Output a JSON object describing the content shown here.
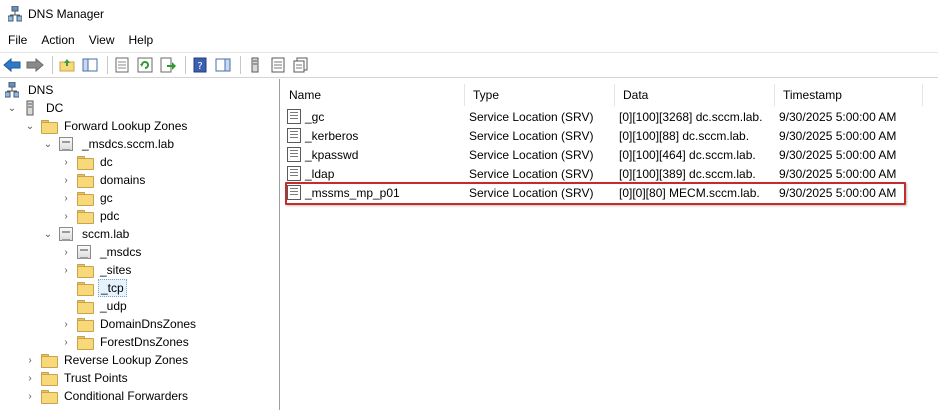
{
  "window": {
    "title": "DNS Manager",
    "icon": "dns-manager-icon"
  },
  "menu": [
    "File",
    "Action",
    "View",
    "Help"
  ],
  "toolbar": {
    "buttons": [
      "back-arrow-icon",
      "forward-arrow-icon",
      "up-folder-icon",
      "show-hide-tree-icon",
      "properties-icon",
      "refresh-icon",
      "export-list-icon",
      "help-icon",
      "action-pane-icon",
      "server-icon",
      "zone-icon",
      "records-icon"
    ]
  },
  "tree": {
    "root": "DNS",
    "server": "DC",
    "forward_zones": "Forward Lookup Zones",
    "msdcs_zone": "_msdcs.sccm.lab",
    "msdcs_children": [
      "dc",
      "domains",
      "gc",
      "pdc"
    ],
    "sccm_zone": "sccm.lab",
    "sccm_children": [
      "_msdcs",
      "_sites",
      "_tcp",
      "_udp",
      "DomainDnsZones",
      "ForestDnsZones"
    ],
    "reverse_zones": "Reverse Lookup Zones",
    "trust_points": "Trust Points",
    "conditional_forwarders": "Conditional Forwarders",
    "selected": "_tcp"
  },
  "list": {
    "columns": [
      "Name",
      "Type",
      "Data",
      "Timestamp"
    ],
    "rows": [
      {
        "name": "_gc",
        "type": "Service Location (SRV)",
        "data": "[0][100][3268] dc.sccm.lab.",
        "timestamp": "9/30/2025 5:00:00 AM"
      },
      {
        "name": "_kerberos",
        "type": "Service Location (SRV)",
        "data": "[0][100][88] dc.sccm.lab.",
        "timestamp": "9/30/2025 5:00:00 AM"
      },
      {
        "name": "_kpasswd",
        "type": "Service Location (SRV)",
        "data": "[0][100][464] dc.sccm.lab.",
        "timestamp": "9/30/2025 5:00:00 AM"
      },
      {
        "name": "_ldap",
        "type": "Service Location (SRV)",
        "data": "[0][100][389] dc.sccm.lab.",
        "timestamp": "9/30/2025 5:00:00 AM"
      },
      {
        "name": "_mssms_mp_p01",
        "type": "Service Location (SRV)",
        "data": "[0][0][80] MECM.sccm.lab.",
        "timestamp": "9/30/2025 5:00:00 AM"
      }
    ],
    "highlighted_row": "_mssms_mp_p01",
    "highlight_color": "#c42b2b"
  }
}
